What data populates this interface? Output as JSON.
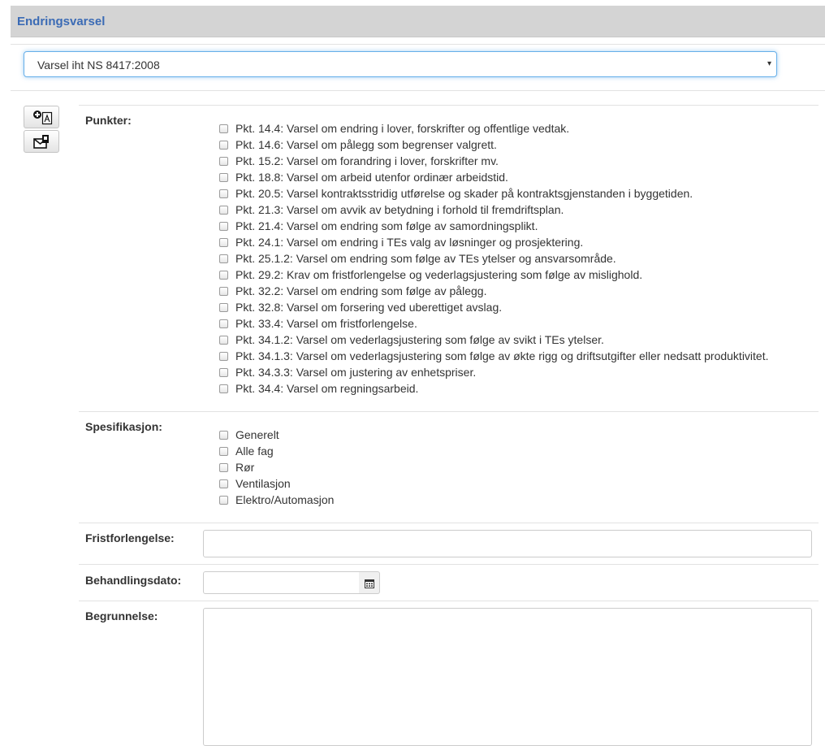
{
  "header": {
    "title": "Endringsvarsel"
  },
  "variant_select": {
    "value": "Varsel iht NS 8417:2008",
    "caret": "▾"
  },
  "toolbar": {
    "add_pdf_icon": "add-pdf-icon",
    "mail_attachment_icon": "mail-attachment-icon"
  },
  "punkter": {
    "label": "Punkter:",
    "items": [
      {
        "label": "Pkt. 14.4: Varsel om endring i lover, forskrifter og offentlige vedtak.",
        "checked": false
      },
      {
        "label": "Pkt. 14.6: Varsel om pålegg som begrenser valgrett.",
        "checked": false
      },
      {
        "label": "Pkt. 15.2: Varsel om forandring i lover, forskrifter mv.",
        "checked": false
      },
      {
        "label": "Pkt. 18.8: Varsel om arbeid utenfor ordinær arbeidstid.",
        "checked": false
      },
      {
        "label": "Pkt. 20.5: Varsel kontraktsstridig utførelse og skader på kontraktsgjenstanden i byggetiden.",
        "checked": false
      },
      {
        "label": "Pkt. 21.3: Varsel om avvik av betydning i forhold til fremdriftsplan.",
        "checked": false
      },
      {
        "label": "Pkt. 21.4: Varsel om endring som følge av samordningsplikt.",
        "checked": false
      },
      {
        "label": "Pkt. 24.1: Varsel om endring i TEs valg av løsninger og prosjektering.",
        "checked": false
      },
      {
        "label": "Pkt. 25.1.2: Varsel om endring som følge av TEs ytelser og ansvarsområde.",
        "checked": false
      },
      {
        "label": "Pkt. 29.2: Krav om fristforlengelse og vederlagsjustering som følge av mislighold.",
        "checked": false
      },
      {
        "label": "Pkt. 32.2: Varsel om endring som følge av pålegg.",
        "checked": false
      },
      {
        "label": "Pkt. 32.8: Varsel om forsering ved uberettiget avslag.",
        "checked": false
      },
      {
        "label": "Pkt. 33.4: Varsel om fristforlengelse.",
        "checked": false
      },
      {
        "label": "Pkt. 34.1.2: Varsel om vederlagsjustering som følge av svikt i TEs ytelser.",
        "checked": false
      },
      {
        "label": "Pkt. 34.1.3: Varsel om vederlagsjustering som følge av økte rigg og driftsutgifter eller nedsatt produktivitet.",
        "checked": false
      },
      {
        "label": "Pkt. 34.3.3: Varsel om justering av enhetspriser.",
        "checked": false
      },
      {
        "label": "Pkt. 34.4: Varsel om regningsarbeid.",
        "checked": false
      }
    ]
  },
  "spesifikasjon": {
    "label": "Spesifikasjon:",
    "items": [
      {
        "label": "Generelt",
        "checked": false
      },
      {
        "label": "Alle fag",
        "checked": false
      },
      {
        "label": "Rør",
        "checked": false
      },
      {
        "label": "Ventilasjon",
        "checked": false
      },
      {
        "label": "Elektro/Automasjon",
        "checked": false
      }
    ]
  },
  "fristforlengelse": {
    "label": "Fristforlengelse:",
    "value": ""
  },
  "behandlingsdato": {
    "label": "Behandlingsdato:",
    "value": "",
    "icon": "calendar-icon"
  },
  "begrunnelse": {
    "label": "Begrunnelse:",
    "value": ""
  }
}
